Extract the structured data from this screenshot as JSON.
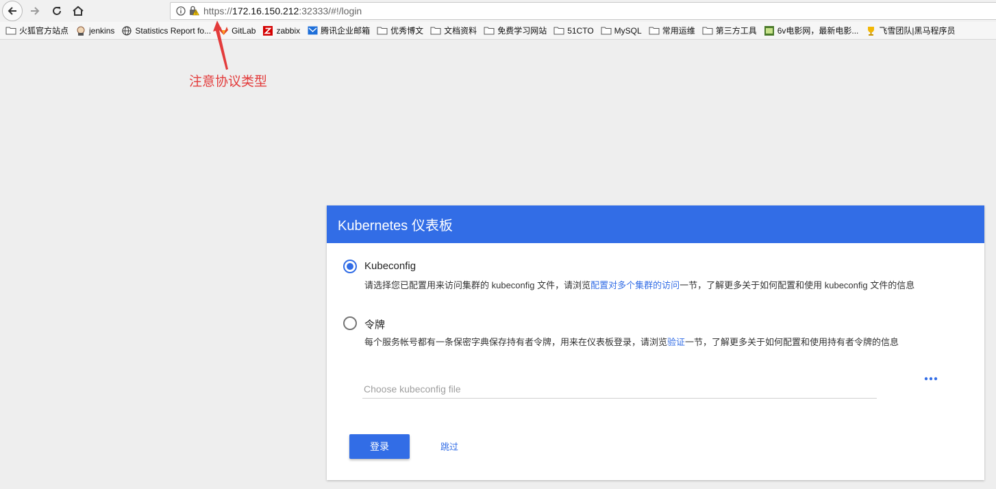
{
  "browser": {
    "url_scheme": "https://",
    "url_host": "172.16.150.212",
    "url_rest": ":32333/#!/login",
    "bookmarks": [
      {
        "label": "火狐官方站点",
        "icon": "folder-icon"
      },
      {
        "label": "jenkins",
        "icon": "jenkins-icon"
      },
      {
        "label": "Statistics Report fo...",
        "icon": "globe-icon"
      },
      {
        "label": "GitLab",
        "icon": "gitlab-icon"
      },
      {
        "label": "zabbix",
        "icon": "zabbix-icon"
      },
      {
        "label": "腾讯企业邮箱",
        "icon": "mail-icon"
      },
      {
        "label": "优秀博文",
        "icon": "folder-icon"
      },
      {
        "label": "文档资料",
        "icon": "folder-icon"
      },
      {
        "label": "免费学习网站",
        "icon": "folder-icon"
      },
      {
        "label": "51CTO",
        "icon": "folder-icon"
      },
      {
        "label": "MySQL",
        "icon": "folder-icon"
      },
      {
        "label": "常用运维",
        "icon": "folder-icon"
      },
      {
        "label": "第三方工具",
        "icon": "folder-icon"
      },
      {
        "label": "6v电影网，最新电影...",
        "icon": "movie-icon"
      },
      {
        "label": "飞雪团队|黑马程序员",
        "icon": "trophy-icon"
      }
    ]
  },
  "annotation": {
    "text": "注意协议类型",
    "color": "#e33b3b"
  },
  "card": {
    "title": "Kubernetes 仪表板",
    "options": [
      {
        "label": "Kubeconfig",
        "checked": true,
        "desc_before": "请选择您已配置用来访问集群的 kubeconfig 文件，请浏览",
        "desc_link": "配置对多个集群的访问",
        "desc_after": "一节，了解更多关于如何配置和使用 kubeconfig 文件的信息"
      },
      {
        "label": "令牌",
        "checked": false,
        "desc_before": "每个服务帐号都有一条保密字典保存持有者令牌，用来在仪表板登录，请浏览",
        "desc_link": "验证",
        "desc_after": "一节，了解更多关于如何配置和使用持有者令牌的信息"
      }
    ],
    "file_input_placeholder": "Choose kubeconfig file",
    "login_label": "登录",
    "skip_label": "跳过"
  },
  "colors": {
    "accent": "#326de6",
    "background": "#eeeeee"
  }
}
